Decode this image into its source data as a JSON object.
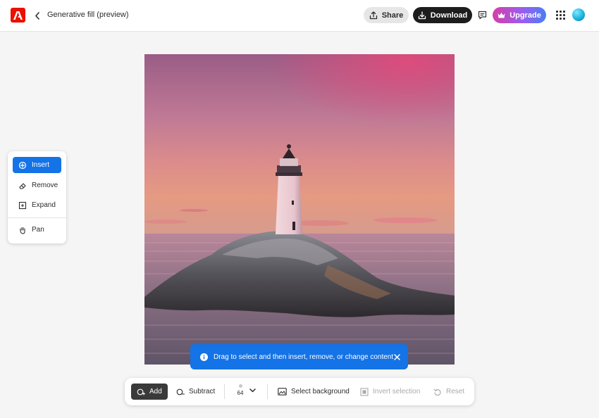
{
  "header": {
    "title": "Generative fill (preview)",
    "share_label": "Share",
    "download_label": "Download",
    "upgrade_label": "Upgrade"
  },
  "tools": {
    "items": [
      {
        "label": "Insert",
        "icon": "insert-icon",
        "active": true
      },
      {
        "label": "Remove",
        "icon": "remove-icon",
        "active": false
      },
      {
        "label": "Expand",
        "icon": "expand-icon",
        "active": false
      },
      {
        "label": "Pan",
        "icon": "hand-icon",
        "active": false
      }
    ]
  },
  "toast": {
    "message": "Drag to select and then insert, remove, or change content"
  },
  "toolbar": {
    "add_label": "Add",
    "subtract_label": "Subtract",
    "brush_size": "64",
    "select_background_label": "Select background",
    "invert_selection_label": "Invert selection",
    "reset_label": "Reset"
  },
  "colors": {
    "accent": "#1473e6",
    "brand": "#eb1000"
  }
}
